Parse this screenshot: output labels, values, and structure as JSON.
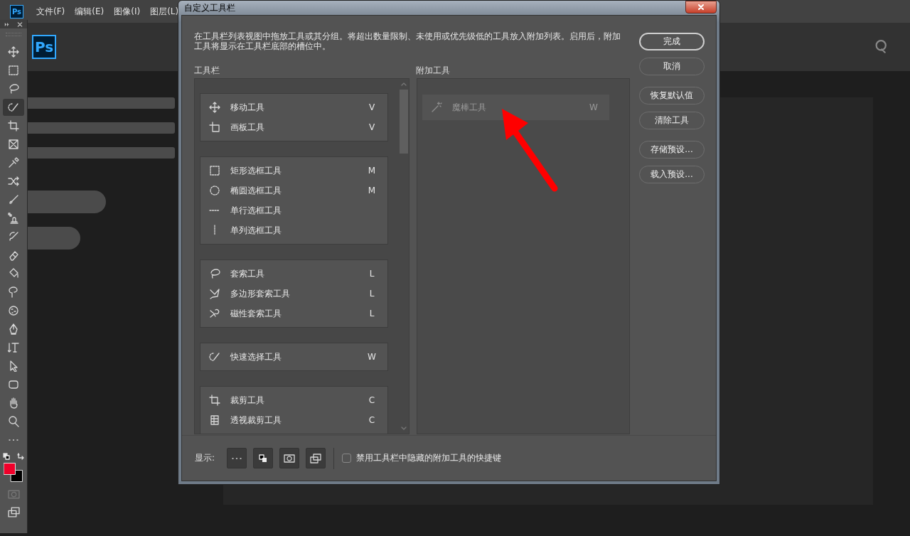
{
  "menubar": {
    "app_icon": "Ps",
    "items": [
      "文件(F)",
      "编辑(E)",
      "图像(I)",
      "图层(L)"
    ]
  },
  "home": {
    "logo": "Ps"
  },
  "toolbar": {
    "tools": [
      {
        "selected": false
      },
      {
        "selected": false
      },
      {
        "selected": false
      },
      {
        "selected": true
      },
      {
        "selected": false
      },
      {
        "selected": false
      },
      {
        "selected": false
      },
      {
        "selected": false
      },
      {
        "selected": false
      },
      {
        "selected": false
      },
      {
        "selected": false
      },
      {
        "selected": false
      },
      {
        "selected": false
      },
      {
        "selected": false
      },
      {
        "selected": false
      },
      {
        "selected": false
      },
      {
        "selected": false
      },
      {
        "selected": false
      },
      {
        "selected": false
      },
      {
        "selected": false
      },
      {
        "selected": false
      },
      {
        "selected": false
      }
    ]
  },
  "dialog": {
    "title": "自定义工具栏",
    "description": "在工具栏列表视图中拖放工具或其分组。将超出数量限制、未使用或优先级低的工具放入附加列表。启用后，附加工具将显示在工具栏底部的槽位中。",
    "toolbar_label": "工具栏",
    "extra_label": "附加工具",
    "groups": [
      {
        "tools": [
          {
            "name": "移动工具",
            "shortcut": "V"
          },
          {
            "name": "画板工具",
            "shortcut": "V"
          }
        ]
      },
      {
        "tools": [
          {
            "name": "矩形选框工具",
            "shortcut": "M"
          },
          {
            "name": "椭圆选框工具",
            "shortcut": "M"
          },
          {
            "name": "单行选框工具"
          },
          {
            "name": "单列选框工具"
          }
        ]
      },
      {
        "tools": [
          {
            "name": "套索工具",
            "shortcut": "L"
          },
          {
            "name": "多边形套索工具",
            "shortcut": "L"
          },
          {
            "name": "磁性套索工具",
            "shortcut": "L"
          }
        ]
      },
      {
        "tools": [
          {
            "name": "快速选择工具",
            "shortcut": "W"
          }
        ]
      },
      {
        "tools": [
          {
            "name": "裁剪工具",
            "shortcut": "C"
          },
          {
            "name": "透视裁剪工具",
            "shortcut": "C"
          }
        ]
      }
    ],
    "extra_tools": [
      {
        "name": "魔棒工具",
        "shortcut": "W",
        "faded": true
      }
    ],
    "button_groups": [
      [
        {
          "label": "完成",
          "default": true
        },
        {
          "label": "取消",
          "default": false
        }
      ],
      [
        {
          "label": "恢复默认值",
          "default": false
        },
        {
          "label": "清除工具",
          "default": false
        }
      ],
      [
        {
          "label": "存储预设...",
          "default": false
        },
        {
          "label": "载入预设...",
          "default": false
        }
      ]
    ],
    "show_label": "显示:",
    "checkbox": {
      "label": "禁用工具栏中隐藏的附加工具的快捷键",
      "checked": false
    }
  }
}
